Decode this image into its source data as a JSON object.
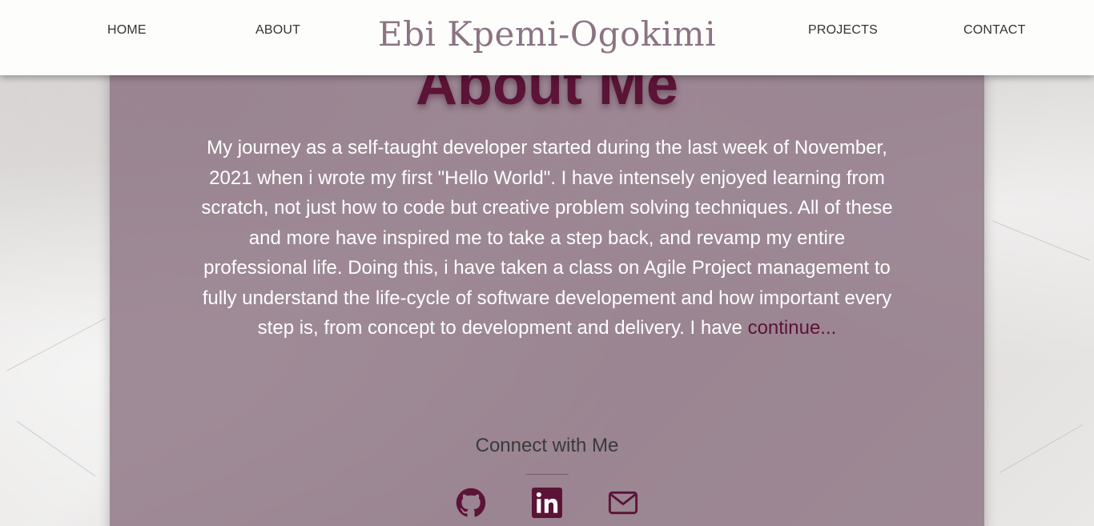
{
  "nav": {
    "home": "HOME",
    "about": "ABOUT",
    "brand": "Ebi Kpemi-Ogokimi",
    "projects": "PROJECTS",
    "contact": "CONTACT"
  },
  "about": {
    "heading": "About Me",
    "body": "My journey as a self-taught developer started during the last week of November, 2021 when i wrote my first \"Hello World\". I have intensely enjoyed learning from scratch, not just how to code but creative problem solving techniques. All of these and more have inspired me to take a step back, and revamp my entire professional life. Doing this, i have taken a class on Agile Project management to fully understand the life-cycle of software developement and how important every step is, from concept to development and delivery. I have ",
    "continue_link": "continue..."
  },
  "connect": {
    "title": "Connect with Me",
    "icons": [
      "github-icon",
      "linkedin-icon",
      "mail-icon"
    ]
  },
  "colors": {
    "accent": "#5b1336",
    "brand": "#8c7383",
    "panel": "#8c7382",
    "navbar": "#fdfdfb"
  }
}
